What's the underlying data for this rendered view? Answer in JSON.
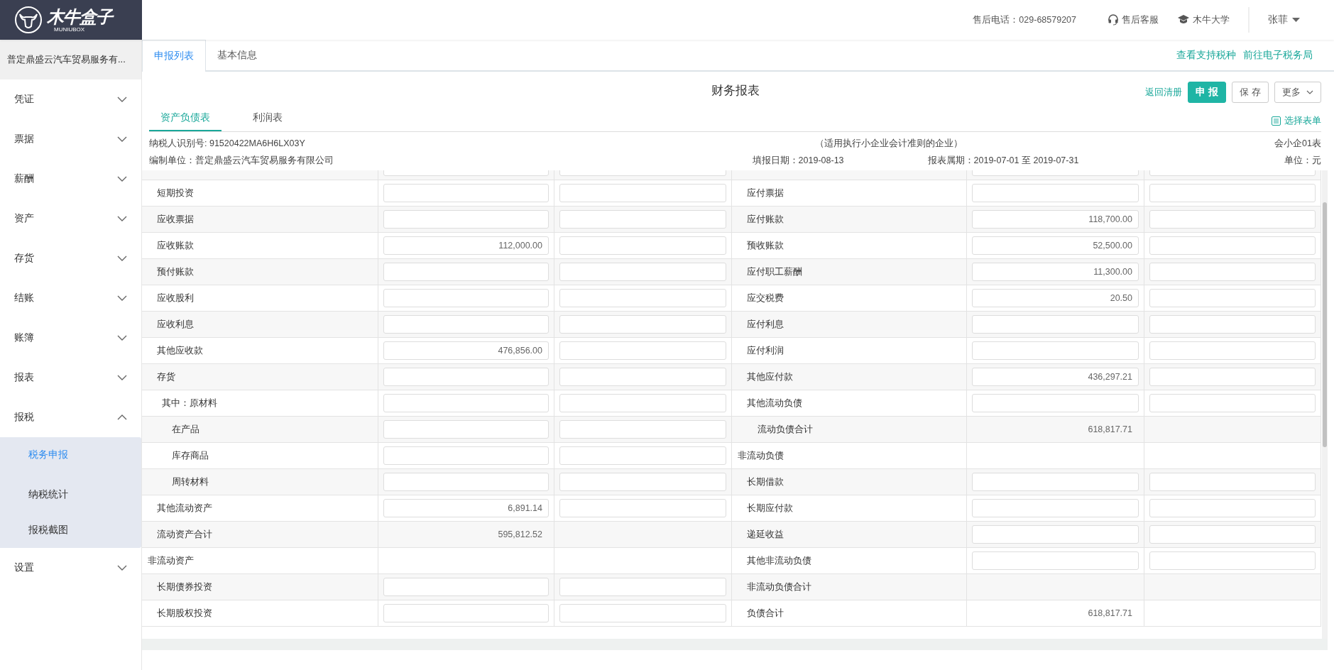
{
  "header": {
    "logo": {
      "text": "木牛盒子",
      "subtext": "MUNIUBOX"
    },
    "hotline": "售后电话：029-68579207",
    "support": "售后客服",
    "academy": "木牛大学",
    "user": "张菲"
  },
  "sidebar": {
    "company": "普定鼎盛云汽车贸易服务有...",
    "items": [
      {
        "label": "凭证",
        "expanded": false
      },
      {
        "label": "票据",
        "expanded": false
      },
      {
        "label": "薪酬",
        "expanded": false
      },
      {
        "label": "资产",
        "expanded": false
      },
      {
        "label": "存货",
        "expanded": false
      },
      {
        "label": "结账",
        "expanded": false
      },
      {
        "label": "账簿",
        "expanded": false
      },
      {
        "label": "报表",
        "expanded": false
      },
      {
        "label": "报税",
        "expanded": true,
        "children": [
          {
            "label": "税务申报",
            "selected": true
          },
          {
            "label": "纳税统计",
            "selected": false
          },
          {
            "label": "报税截图",
            "selected": false
          }
        ]
      },
      {
        "label": "设置",
        "expanded": false
      }
    ]
  },
  "tabs": [
    {
      "label": "申报列表",
      "selected": true
    },
    {
      "label": "基本信息",
      "selected": false
    }
  ],
  "top_links": [
    "查看支持税种",
    "前往电子税务局"
  ],
  "report": {
    "title": "财务报表",
    "return_link": "返回清册",
    "buttons": [
      {
        "label": "申 报",
        "kind": "primary"
      },
      {
        "label": "保 存",
        "kind": "default"
      },
      {
        "label": "更多",
        "kind": "dropdown"
      }
    ],
    "select_form": "选择表单",
    "sheet_tabs": [
      {
        "label": "资产负债表",
        "selected": true
      },
      {
        "label": "利润表",
        "selected": false
      }
    ],
    "taxpayer_id": "纳税人识别号: 91520422MA6H6LX03Y",
    "standard": "（适用执行小企业会计准则的企业）",
    "form_code": "会小企01表",
    "unit_name": "编制单位：普定鼎盛云汽车贸易服务有限公司",
    "fill_date": "填报日期：2019-08-13",
    "period": "报表属期：2019-07-01 至 2019-07-31",
    "currency": "单位：元",
    "rows": [
      {
        "left": {
          "label": "短期投资",
          "kind": "item",
          "cells": [
            {
              "kind": "input"
            },
            {
              "kind": "input"
            }
          ]
        },
        "right": {
          "label": "应付票据",
          "kind": "item",
          "cells": [
            {
              "kind": "input"
            },
            {
              "kind": "input"
            }
          ]
        }
      },
      {
        "left": {
          "label": "应收票据",
          "kind": "item",
          "cells": [
            {
              "kind": "input"
            },
            {
              "kind": "input"
            }
          ]
        },
        "right": {
          "label": "应付账款",
          "kind": "item",
          "cells": [
            {
              "kind": "input",
              "value": "118,700.00"
            },
            {
              "kind": "input"
            }
          ]
        }
      },
      {
        "left": {
          "label": "应收账款",
          "kind": "item",
          "cells": [
            {
              "kind": "input",
              "value": "112,000.00"
            },
            {
              "kind": "input"
            }
          ]
        },
        "right": {
          "label": "预收账款",
          "kind": "item",
          "cells": [
            {
              "kind": "input",
              "value": "52,500.00"
            },
            {
              "kind": "input"
            }
          ]
        }
      },
      {
        "left": {
          "label": "预付账款",
          "kind": "item",
          "cells": [
            {
              "kind": "input"
            },
            {
              "kind": "input"
            }
          ]
        },
        "right": {
          "label": "应付职工薪酬",
          "kind": "item",
          "cells": [
            {
              "kind": "input",
              "value": "11,300.00"
            },
            {
              "kind": "input"
            }
          ]
        }
      },
      {
        "left": {
          "label": "应收股利",
          "kind": "item",
          "cells": [
            {
              "kind": "input"
            },
            {
              "kind": "input"
            }
          ]
        },
        "right": {
          "label": "应交税费",
          "kind": "item",
          "cells": [
            {
              "kind": "input",
              "value": "20.50"
            },
            {
              "kind": "input"
            }
          ]
        }
      },
      {
        "left": {
          "label": "应收利息",
          "kind": "item",
          "cells": [
            {
              "kind": "input"
            },
            {
              "kind": "input"
            }
          ]
        },
        "right": {
          "label": "应付利息",
          "kind": "item",
          "cells": [
            {
              "kind": "input"
            },
            {
              "kind": "input"
            }
          ]
        }
      },
      {
        "left": {
          "label": "其他应收款",
          "kind": "item",
          "cells": [
            {
              "kind": "input",
              "value": "476,856.00"
            },
            {
              "kind": "input"
            }
          ]
        },
        "right": {
          "label": "应付利润",
          "kind": "item",
          "cells": [
            {
              "kind": "input"
            },
            {
              "kind": "input"
            }
          ]
        }
      },
      {
        "left": {
          "label": "存货",
          "kind": "item",
          "cells": [
            {
              "kind": "input"
            },
            {
              "kind": "input"
            }
          ]
        },
        "right": {
          "label": "其他应付款",
          "kind": "item",
          "cells": [
            {
              "kind": "input",
              "value": "436,297.21"
            },
            {
              "kind": "input"
            }
          ]
        }
      },
      {
        "left": {
          "label": "其中：原材料",
          "kind": "sub",
          "cells": [
            {
              "kind": "input"
            },
            {
              "kind": "input"
            }
          ]
        },
        "right": {
          "label": "其他流动负债",
          "kind": "item",
          "cells": [
            {
              "kind": "input"
            },
            {
              "kind": "input"
            }
          ]
        }
      },
      {
        "left": {
          "label": "在产品",
          "kind": "detail",
          "cells": [
            {
              "kind": "input"
            },
            {
              "kind": "input"
            }
          ]
        },
        "right": {
          "label": "流动负债合计",
          "kind": "indented_total",
          "cells": [
            {
              "kind": "total",
              "value": "618,817.71"
            },
            {
              "kind": "blank"
            }
          ]
        }
      },
      {
        "left": {
          "label": "库存商品",
          "kind": "detail",
          "cells": [
            {
              "kind": "input"
            },
            {
              "kind": "input"
            }
          ]
        },
        "right": {
          "label": "非流动负债",
          "kind": "section",
          "cells": [
            {
              "kind": "blank"
            },
            {
              "kind": "blank"
            }
          ]
        }
      },
      {
        "left": {
          "label": "周转材料",
          "kind": "detail",
          "cells": [
            {
              "kind": "input"
            },
            {
              "kind": "input"
            }
          ]
        },
        "right": {
          "label": "长期借款",
          "kind": "item",
          "cells": [
            {
              "kind": "input"
            },
            {
              "kind": "input"
            }
          ]
        }
      },
      {
        "left": {
          "label": "其他流动资产",
          "kind": "item",
          "cells": [
            {
              "kind": "input",
              "value": "6,891.14"
            },
            {
              "kind": "input"
            }
          ]
        },
        "right": {
          "label": "长期应付款",
          "kind": "item",
          "cells": [
            {
              "kind": "input"
            },
            {
              "kind": "input"
            }
          ]
        }
      },
      {
        "left": {
          "label": "流动资产合计",
          "kind": "item",
          "cells": [
            {
              "kind": "total",
              "value": "595,812.52"
            },
            {
              "kind": "blank"
            }
          ]
        },
        "right": {
          "label": "递延收益",
          "kind": "item",
          "cells": [
            {
              "kind": "input"
            },
            {
              "kind": "input"
            }
          ]
        }
      },
      {
        "left": {
          "label": "非流动资产",
          "kind": "section",
          "cells": [
            {
              "kind": "blank"
            },
            {
              "kind": "blank"
            }
          ]
        },
        "right": {
          "label": "其他非流动负债",
          "kind": "item",
          "cells": [
            {
              "kind": "input"
            },
            {
              "kind": "input"
            }
          ]
        }
      },
      {
        "left": {
          "label": "长期债券投资",
          "kind": "item",
          "cells": [
            {
              "kind": "input"
            },
            {
              "kind": "input"
            }
          ]
        },
        "right": {
          "label": "非流动负债合计",
          "kind": "item",
          "cells": [
            {
              "kind": "blank"
            },
            {
              "kind": "blank"
            }
          ]
        }
      },
      {
        "left": {
          "label": "长期股权投资",
          "kind": "item",
          "cells": [
            {
              "kind": "input"
            },
            {
              "kind": "input"
            }
          ]
        },
        "right": {
          "label": "负债合计",
          "kind": "item",
          "cells": [
            {
              "kind": "total",
              "value": "618,817.71"
            },
            {
              "kind": "blank"
            }
          ]
        }
      }
    ]
  }
}
